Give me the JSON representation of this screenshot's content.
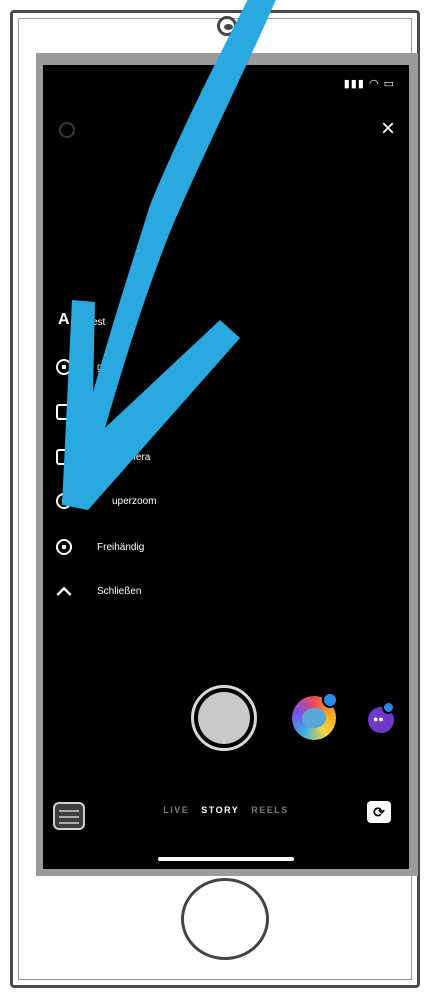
{
  "status": {
    "icons": "▮▮▮ ◠ ▭"
  },
  "top": {
    "close_label": "×"
  },
  "menu": {
    "heading_letter": "A",
    "items": [
      {
        "label": "est",
        "icon": "partial"
      },
      {
        "label": "g",
        "icon": "ring"
      },
      {
        "label": "",
        "icon": "square"
      },
      {
        "label": "amera",
        "icon": "square"
      },
      {
        "label": "uperzoom",
        "icon": "ring"
      },
      {
        "label": "Freihändig",
        "icon": "record-ring"
      },
      {
        "label": "Schließen",
        "icon": "chevron-up"
      }
    ]
  },
  "modes": {
    "live": "LIVE",
    "story": "STORY",
    "reels": "REELS"
  },
  "colors": {
    "arrow": "#2aa8e0",
    "screen": "#000000",
    "bezel": "#9b9b9b"
  }
}
